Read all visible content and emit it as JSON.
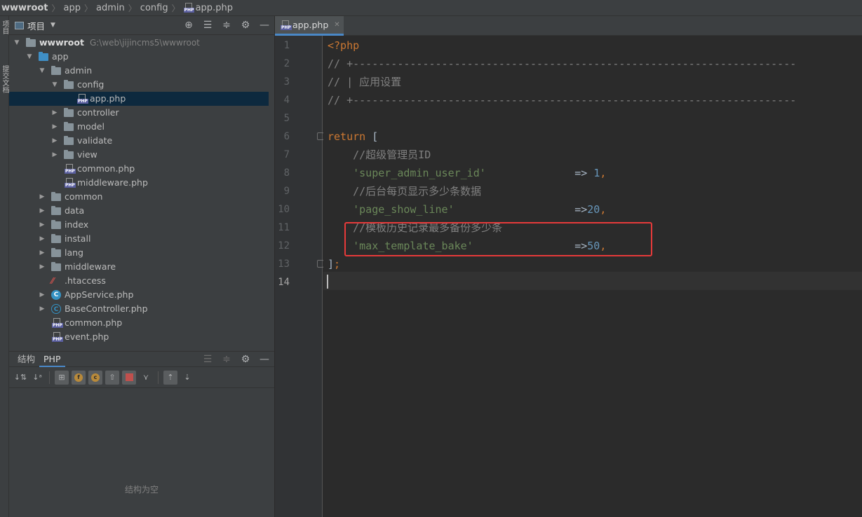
{
  "breadcrumb": [
    "wwwroot",
    "app",
    "admin",
    "config",
    "app.php"
  ],
  "breadcrumb_file_icon": "php-file-icon",
  "side_strip": {
    "top_label": "项目",
    "bottom_label": "提交文档"
  },
  "project_panel": {
    "title": "项目",
    "root_name": "wwwroot",
    "root_path": "G:\\web\\jijincms5\\wwwroot",
    "tree": [
      {
        "label": "app",
        "type": "folder-blue",
        "depth": 1,
        "expanded": true
      },
      {
        "label": "admin",
        "type": "folder",
        "depth": 2,
        "expanded": true
      },
      {
        "label": "config",
        "type": "folder",
        "depth": 3,
        "expanded": true
      },
      {
        "label": "app.php",
        "type": "php",
        "depth": 4,
        "selected": true
      },
      {
        "label": "controller",
        "type": "folder",
        "depth": 3,
        "expanded": false
      },
      {
        "label": "model",
        "type": "folder",
        "depth": 3,
        "expanded": false
      },
      {
        "label": "validate",
        "type": "folder",
        "depth": 3,
        "expanded": false
      },
      {
        "label": "view",
        "type": "folder",
        "depth": 3,
        "expanded": false
      },
      {
        "label": "common.php",
        "type": "php",
        "depth": 3
      },
      {
        "label": "middleware.php",
        "type": "php",
        "depth": 3
      },
      {
        "label": "common",
        "type": "folder",
        "depth": 2,
        "expanded": false
      },
      {
        "label": "data",
        "type": "folder",
        "depth": 2,
        "expanded": false
      },
      {
        "label": "index",
        "type": "folder",
        "depth": 2,
        "expanded": false
      },
      {
        "label": "install",
        "type": "folder",
        "depth": 2,
        "expanded": false
      },
      {
        "label": "lang",
        "type": "folder",
        "depth": 2,
        "expanded": false
      },
      {
        "label": "middleware",
        "type": "folder",
        "depth": 2,
        "expanded": false
      },
      {
        "label": ".htaccess",
        "type": "htaccess",
        "depth": 2
      },
      {
        "label": "AppService.php",
        "type": "class",
        "depth": 2,
        "expanded": false
      },
      {
        "label": "BaseController.php",
        "type": "class-abstract",
        "depth": 2,
        "expanded": false
      },
      {
        "label": "common.php",
        "type": "php",
        "depth": 2
      },
      {
        "label": "event.php",
        "type": "php",
        "depth": 2
      }
    ]
  },
  "structure_panel": {
    "tabs": [
      "结构",
      "PHP"
    ],
    "active_tab": "PHP",
    "empty_message": "结构为空"
  },
  "editor": {
    "tab_label": "app.php",
    "current_line": 14,
    "lines": [
      {
        "n": "1",
        "tokens": [
          {
            "t": "<?php",
            "c": "kw"
          }
        ]
      },
      {
        "n": "2",
        "tokens": [
          {
            "t": "// +----------------------------------------------------------------------",
            "c": "cm"
          }
        ]
      },
      {
        "n": "3",
        "tokens": [
          {
            "t": "// | 应用设置",
            "c": "cm"
          }
        ]
      },
      {
        "n": "4",
        "tokens": [
          {
            "t": "// +----------------------------------------------------------------------",
            "c": "cm"
          }
        ]
      },
      {
        "n": "5",
        "tokens": []
      },
      {
        "n": "6",
        "tokens": [
          {
            "t": "return",
            "c": "kw"
          },
          {
            "t": " [",
            "c": "br"
          }
        ]
      },
      {
        "n": "7",
        "tokens": [
          {
            "t": "    //超级管理员ID",
            "c": "cm"
          }
        ]
      },
      {
        "n": "8",
        "tokens": [
          {
            "t": "    'super_admin_user_id'",
            "c": "str"
          },
          {
            "t": "              => ",
            "c": "op"
          },
          {
            "t": "1",
            "c": "num"
          },
          {
            "t": ",",
            "c": "kw"
          }
        ]
      },
      {
        "n": "9",
        "tokens": [
          {
            "t": "    //后台每页显示多少条数据",
            "c": "cm"
          }
        ]
      },
      {
        "n": "10",
        "tokens": [
          {
            "t": "    'page_show_line'",
            "c": "str"
          },
          {
            "t": "                   =>",
            "c": "op"
          },
          {
            "t": "20",
            "c": "num"
          },
          {
            "t": ",",
            "c": "kw"
          }
        ]
      },
      {
        "n": "11",
        "tokens": [
          {
            "t": "    //模板历史记录最多备份多少条",
            "c": "cm"
          }
        ]
      },
      {
        "n": "12",
        "tokens": [
          {
            "t": "    'max_template_bake'",
            "c": "str"
          },
          {
            "t": "                =>",
            "c": "op"
          },
          {
            "t": "50",
            "c": "num"
          },
          {
            "t": ",",
            "c": "kw"
          }
        ]
      },
      {
        "n": "13",
        "tokens": [
          {
            "t": "]",
            "c": "br"
          },
          {
            "t": ";",
            "c": "kw"
          }
        ]
      },
      {
        "n": "14",
        "tokens": []
      }
    ]
  },
  "colors": {
    "highlight_box": "#e63a3a",
    "selection": "#0d293e",
    "accent": "#4a88c7"
  }
}
